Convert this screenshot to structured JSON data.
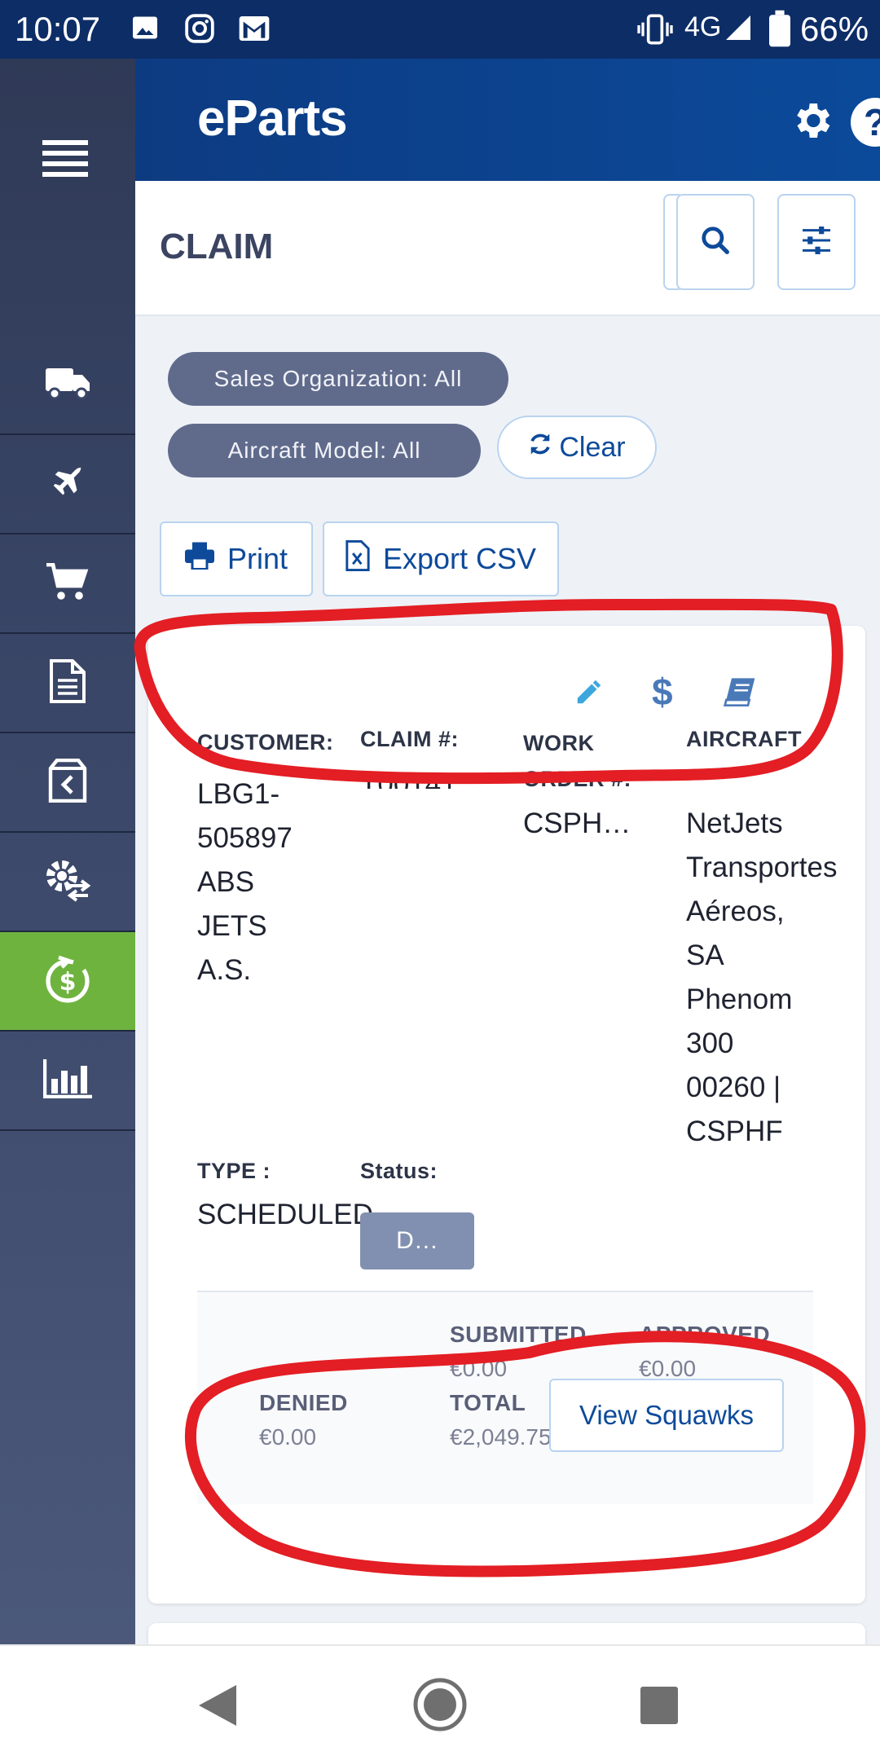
{
  "status_bar": {
    "time": "10:07",
    "network": "4G",
    "battery": "66%",
    "icons": [
      "image-icon",
      "instagram-icon",
      "gmail-icon",
      "vibrate-icon",
      "signal-icon",
      "battery-icon"
    ]
  },
  "app": {
    "brand": "eParts",
    "icons": [
      "settings-gear-icon",
      "help-icon"
    ]
  },
  "sidebar": {
    "items": [
      "truck-icon",
      "airplane-icon",
      "cart-icon",
      "document-icon",
      "return-box-icon",
      "gear-exchange-icon",
      "claim-dollar-icon",
      "bar-chart-icon"
    ],
    "active_index": 6
  },
  "page": {
    "title": "CLAIM"
  },
  "filters": {
    "sales_org": "Sales Organization: All",
    "aircraft_model": "Aircraft Model: All",
    "clear_label": "Clear"
  },
  "toolbar": {
    "print_label": "Print",
    "export_label": "Export CSV"
  },
  "claim": {
    "customer_label": "CUSTOMER:",
    "customer_lines": [
      "LBG1-",
      "505897",
      "ABS",
      "JETS",
      "A.S."
    ],
    "claim_no_label": "CLAIM #:",
    "claim_no_value": "T00141",
    "work_order_label_lines": [
      "WORK",
      "ORDER #:"
    ],
    "work_order_value": "CSPH…",
    "aircraft_label": "AIRCRAFT",
    "aircraft_lines": [
      "NetJets",
      "Transportes",
      "Aéreos,",
      "SA",
      "Phenom",
      "300",
      "00260 |",
      "CSPHF"
    ],
    "type_label": "TYPE :",
    "type_value": "SCHEDULED",
    "status_label": "Status:",
    "status_value": "D…",
    "actions": [
      "pencil-icon",
      "dollar-icon",
      "book-icon"
    ]
  },
  "summary": {
    "submitted_label": "SUBMITTED",
    "submitted_value": "€0.00",
    "approved_label": "APPROVED",
    "approved_value": "€0.00",
    "denied_label": "DENIED",
    "denied_value": "€0.00",
    "total_label": "TOTAL",
    "total_value": "€2,049.75",
    "view_squawks_label": "View Squawks"
  },
  "colors": {
    "header_blue": "#0d3b82",
    "sidebar_active": "#6fb33f",
    "pill_bg": "#606b8c",
    "accent_link": "#0d4a9a",
    "annotation_red": "#e31e24"
  },
  "nav": {
    "icons": [
      "back-icon",
      "home-icon",
      "recents-icon"
    ]
  }
}
